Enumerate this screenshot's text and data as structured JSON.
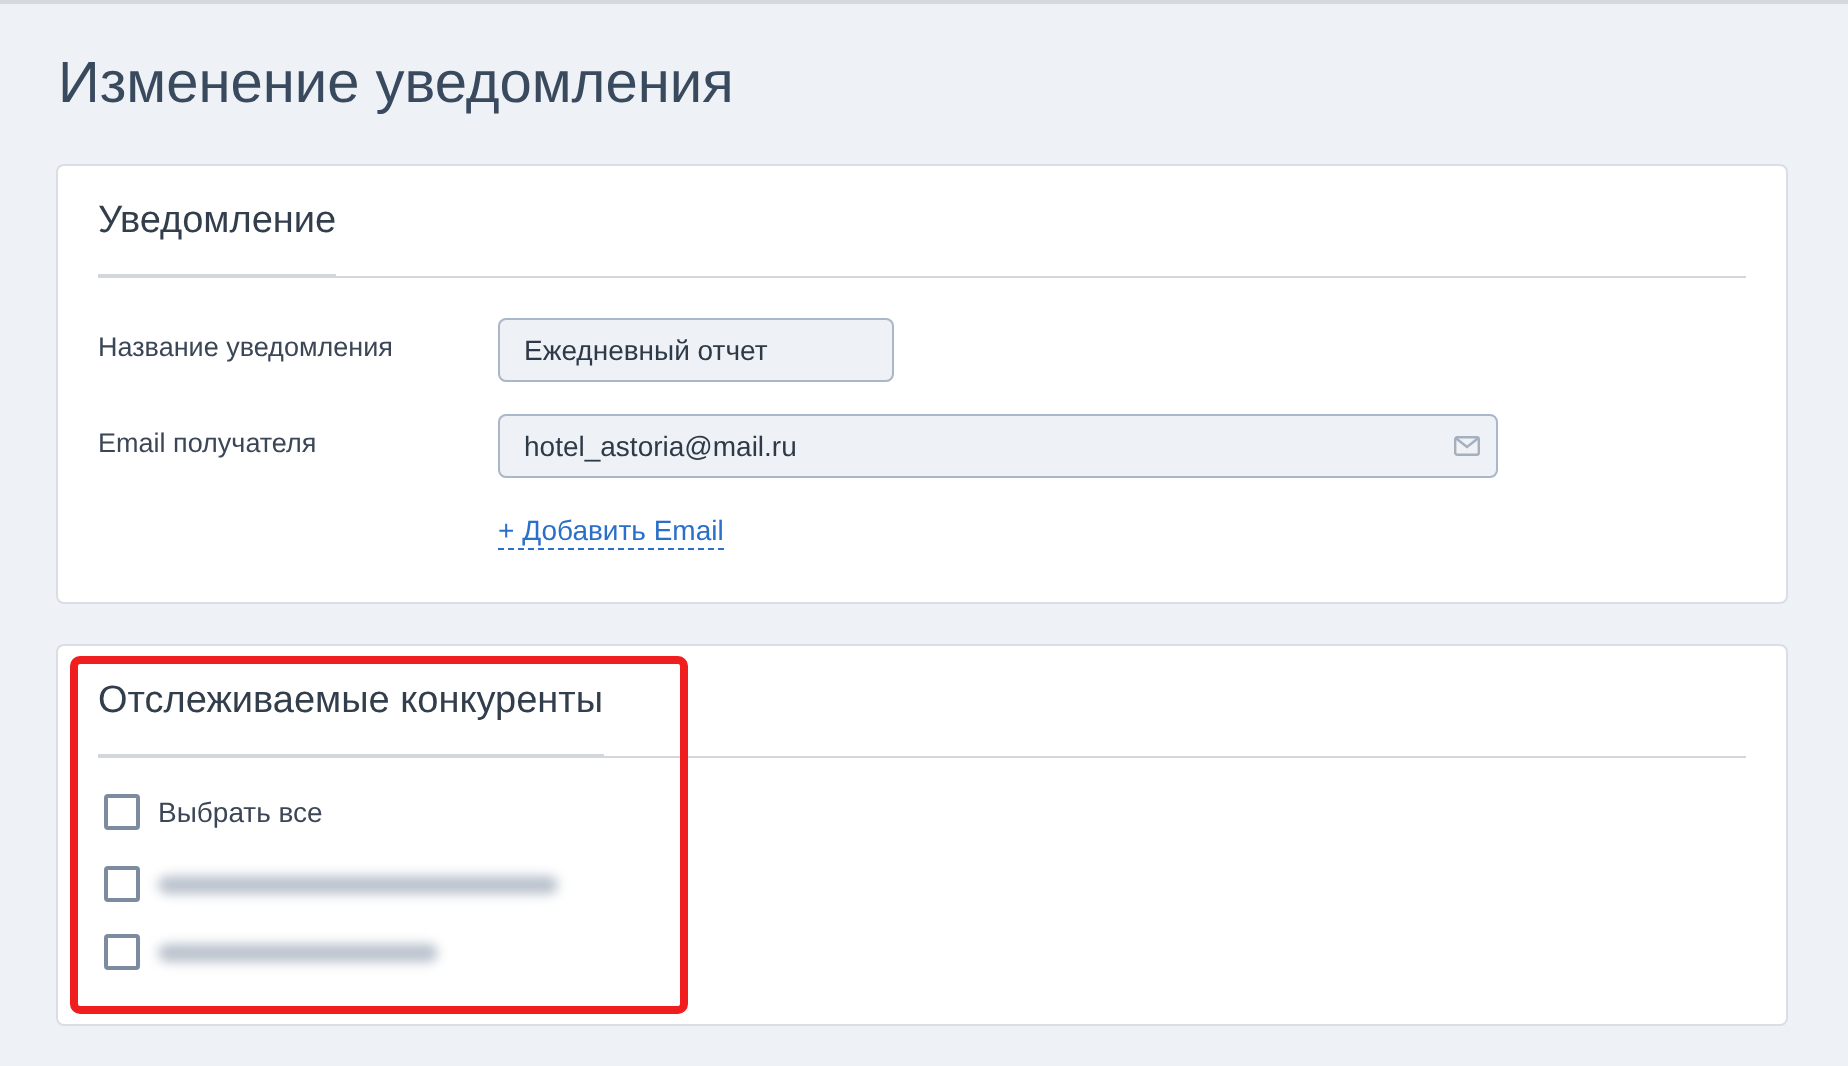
{
  "page_title": "Изменение уведомления",
  "notification": {
    "title": "Уведомление",
    "fields": [
      {
        "label": "Название уведомления",
        "value": "Ежедневный отчет",
        "kind": "text"
      },
      {
        "label": "Email получателя",
        "value": "hotel_astoria@mail.ru",
        "kind": "email"
      }
    ],
    "add_link": "+ Добавить Email"
  },
  "competitors": {
    "title": "Отслеживаемые конкуренты",
    "highlighted": true,
    "items": [
      {
        "kind": "labeled",
        "label": "Выбрать все",
        "checked": false
      },
      {
        "kind": "blurred",
        "checked": false
      },
      {
        "kind": "blurred",
        "checked": false
      }
    ]
  }
}
